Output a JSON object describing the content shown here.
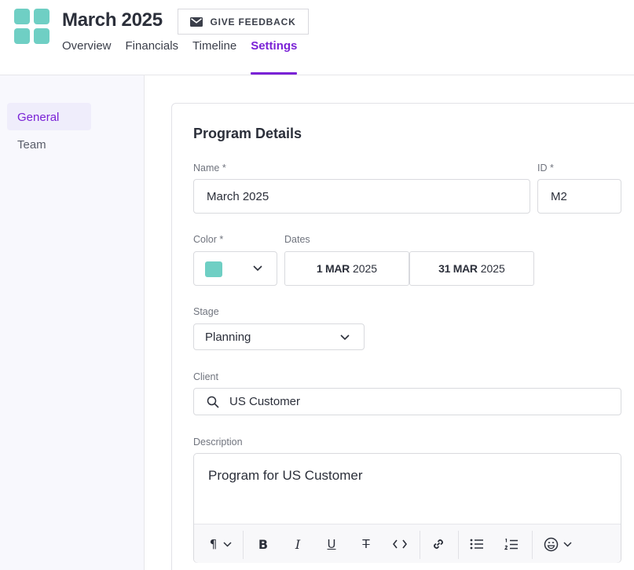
{
  "header": {
    "title": "March 2025",
    "feedback_label": "GIVE FEEDBACK",
    "tabs": [
      {
        "label": "Overview"
      },
      {
        "label": "Financials"
      },
      {
        "label": "Timeline"
      },
      {
        "label": "Settings",
        "active": true
      }
    ]
  },
  "sidebar": {
    "items": [
      {
        "label": "General",
        "active": true
      },
      {
        "label": "Team"
      }
    ]
  },
  "form": {
    "section_title": "Program Details",
    "name_label": "Name *",
    "name_value": "March 2025",
    "id_label": "ID *",
    "id_value": "M2",
    "color_label": "Color *",
    "color_value": "#6fcfc4",
    "dates_label": "Dates",
    "start_date": {
      "daymonth": "1 MAR",
      "year": "2025"
    },
    "end_date": {
      "daymonth": "31 MAR",
      "year": "2025"
    },
    "stage_label": "Stage",
    "stage_value": "Planning",
    "client_label": "Client",
    "client_value": "US Customer",
    "description_label": "Description",
    "description_value": "Program for US Customer"
  },
  "toolbar": {
    "icons": [
      "paragraph-icon",
      "bold-icon",
      "italic-icon",
      "underline-icon",
      "strikethrough-icon",
      "code-icon",
      "link-icon",
      "bullet-list-icon",
      "numbered-list-icon",
      "emoji-icon"
    ]
  },
  "colors": {
    "accent": "#7a22d6",
    "logo": "#6fcfc4"
  }
}
